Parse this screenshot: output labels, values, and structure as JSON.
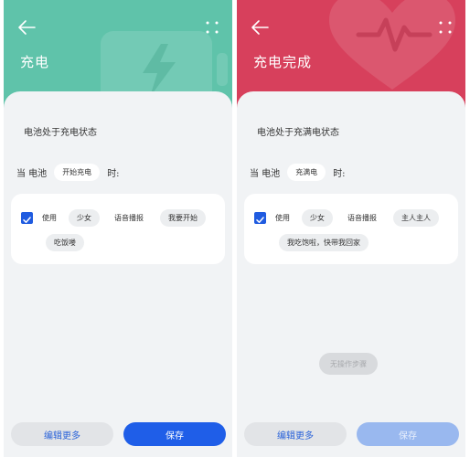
{
  "colors": {
    "charging_header": "#5fc3aa",
    "full_header": "#d7405c",
    "accent": "#1f5ee8"
  },
  "left": {
    "title": "充电",
    "state_text": "电池处于充电状态",
    "when_prefix": "当 电池",
    "when_value": "开始充电",
    "when_suffix": "时:",
    "use_label": "使用",
    "voice": "少女",
    "voice_action": "语音播报",
    "message_part1": "我要开始",
    "message_part2": "吃饭喽",
    "edit_more": "编辑更多",
    "save": "保存"
  },
  "right": {
    "title": "充电完成",
    "state_text": "电池处于充满电状态",
    "when_prefix": "当 电池",
    "when_value": "充满电",
    "when_suffix": "时:",
    "use_label": "使用",
    "voice": "少女",
    "voice_action": "语音播报",
    "message_part1": "主人主人",
    "message_part2": "我吃饱啦，快带我回家",
    "toast": "无操作步骤",
    "edit_more": "编辑更多",
    "save": "保存"
  },
  "icons": {
    "back": "arrow-left-icon",
    "more": "grid-dots-icon",
    "checkbox": "check-icon",
    "charging_deco": "lightning-battery-icon",
    "full_deco": "heart-pulse-icon"
  }
}
